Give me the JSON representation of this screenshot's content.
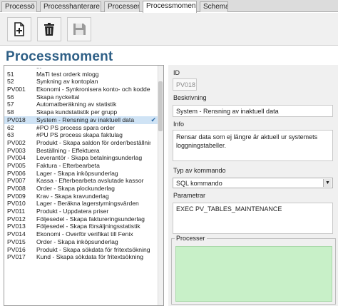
{
  "tabs": [
    {
      "label": "Processö",
      "active": false
    },
    {
      "label": "Processhanterare",
      "active": false
    },
    {
      "label": "Processer",
      "active": false
    },
    {
      "label": "Processmoment",
      "active": true
    },
    {
      "label": "Schema",
      "active": false
    }
  ],
  "toolbar": {
    "buttons": [
      {
        "icon": "add-document-icon",
        "enabled": true
      },
      {
        "icon": "trash-icon",
        "enabled": true
      },
      {
        "icon": "save-icon",
        "enabled": false
      }
    ]
  },
  "page_title": "Processmoment",
  "list": {
    "partial_top": {
      "code": "",
      "name": "..."
    },
    "items": [
      {
        "code": "51",
        "name": "MaTi test orderk mlogg"
      },
      {
        "code": "52",
        "name": "Synkning av kontoplan"
      },
      {
        "code": "PV001",
        "name": "Ekonomi - Synkronisera konto- och koddelar"
      },
      {
        "code": "56",
        "name": "Skapa nyckeltal"
      },
      {
        "code": "57",
        "name": "Automatberäkning av statistik"
      },
      {
        "code": "58",
        "name": "Skapa kundstatistik per grupp"
      },
      {
        "code": "PV018",
        "name": "System - Rensning av inaktuell data",
        "selected": true
      },
      {
        "code": "62",
        "name": "#PO PS process spara order"
      },
      {
        "code": "63",
        "name": "#PU PS process skapa faktulag"
      },
      {
        "code": "PV002",
        "name": "Produkt - Skapa saldon för order/beställning"
      },
      {
        "code": "PV003",
        "name": "Beställning - Effektuera"
      },
      {
        "code": "PV004",
        "name": "Leverantör - Skapa betalningsunderlag"
      },
      {
        "code": "PV005",
        "name": "Faktura - Efterbearbeta"
      },
      {
        "code": "PV006",
        "name": "Lager - Skapa inköpsunderlag"
      },
      {
        "code": "PV007",
        "name": "Kassa - Efterbearbeta avslutade kassor"
      },
      {
        "code": "PV008",
        "name": "Order - Skapa plockunderlag"
      },
      {
        "code": "PV009",
        "name": "Krav - Skapa kravunderlag"
      },
      {
        "code": "PV010",
        "name": "Lager - Beräkna lagerstyrningsvärden"
      },
      {
        "code": "PV011",
        "name": "Produkt - Uppdatera priser"
      },
      {
        "code": "PV012",
        "name": "Följesedel - Skapa faktureringsunderlag"
      },
      {
        "code": "PV013",
        "name": "Följesedel - Skapa försäljningsstatistik"
      },
      {
        "code": "PV014",
        "name": "Ekonomi - Overför verifikat till Fenix"
      },
      {
        "code": "PV015",
        "name": "Order - Skapa inköpsunderlag"
      },
      {
        "code": "PV016",
        "name": "Produkt - Skapa sökdata för fritextsökning"
      },
      {
        "code": "PV017",
        "name": "Kund - Skapa sökdata för fritextsökning"
      }
    ]
  },
  "detail": {
    "id_label": "ID",
    "id_value": "PV018",
    "beskrivning_label": "Beskrivning",
    "beskrivning_value": "System - Rensning av inaktuell data",
    "info_label": "Info",
    "info_value": "Rensar data som ej längre är aktuell ur systemets loggningstabeller.",
    "kommando_label": "Typ av kommando",
    "kommando_value": "SQL kommando",
    "parametrar_label": "Parametrar",
    "parametrar_value": "EXEC PV_TABLES_MAINTENANCE",
    "processer_label": "Processer"
  },
  "colors": {
    "title": "#2e5f86",
    "selected_row": "#cfe3f5",
    "processer_bg": "#c8f0c8"
  }
}
